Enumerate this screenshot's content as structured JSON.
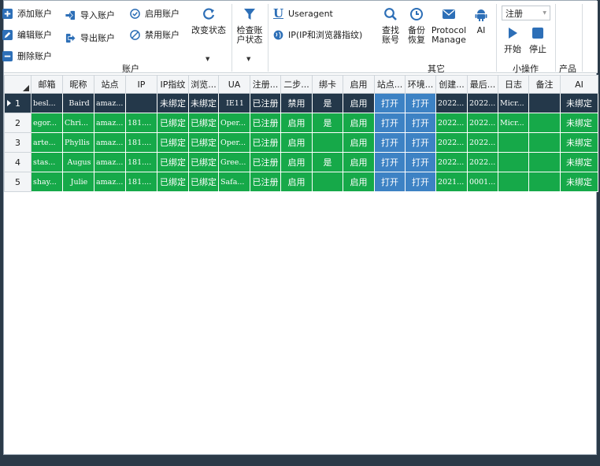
{
  "ribbon": {
    "account": {
      "add": "添加账户",
      "edit": "编辑账户",
      "delete": "删除账户",
      "import": "导入账户",
      "export": "导出账户",
      "enable": "启用账户",
      "disable": "禁用账户",
      "change_status": "改变状态",
      "check_status_l1": "检查账",
      "check_status_l2": "户状态",
      "group_label": "账户"
    },
    "other": {
      "useragent": "Useragent",
      "ip_fingerprint": "IP(IP和浏览器指纹)",
      "find_l1": "查找",
      "find_l2": "账号",
      "backup_l1": "备份",
      "backup_l2": "恢复",
      "protocol_l1": "Protocol",
      "protocol_l2": "Manage",
      "ai": "AI",
      "group_label": "其它"
    },
    "small_ops": {
      "combo_value": "注册",
      "start": "开始",
      "stop": "停止",
      "group_label": "小操作"
    },
    "product": {
      "group_label": "产品"
    }
  },
  "grid": {
    "columns": [
      "邮箱",
      "昵称",
      "站点",
      "IP",
      "IP指纹",
      "浏览...",
      "UA",
      "注册...",
      "二步...",
      "绑卡",
      "启用",
      "站点...",
      "环境...",
      "创建...",
      "最后...",
      "日志",
      "备注",
      "AI"
    ],
    "rows": [
      {
        "n": "1",
        "email": "besl...",
        "nick": "Baird",
        "site": "amaz...",
        "ip": "",
        "ipfp": "未绑定",
        "browser": "未绑定",
        "ua": "IE11",
        "reg": "已注册",
        "twostep": "禁用",
        "card": "是",
        "enabled": "启用",
        "site_open": "打开",
        "env_open": "打开",
        "created": "2022...",
        "last": "2022...",
        "log": "Micr...",
        "note": "",
        "ai": "未绑定"
      },
      {
        "n": "2",
        "email": "egor...",
        "nick": "Chri...",
        "site": "amaz...",
        "ip": "181....",
        "ipfp": "已绑定",
        "browser": "已绑定",
        "ua": "Oper...",
        "reg": "已注册",
        "twostep": "启用",
        "card": "是",
        "enabled": "启用",
        "site_open": "打开",
        "env_open": "打开",
        "created": "2022...",
        "last": "2022...",
        "log": "Micr...",
        "note": "",
        "ai": "未绑定"
      },
      {
        "n": "3",
        "email": "arte...",
        "nick": "Phyllis",
        "site": "amaz...",
        "ip": "181....",
        "ipfp": "已绑定",
        "browser": "已绑定",
        "ua": "Oper...",
        "reg": "已注册",
        "twostep": "启用",
        "card": "",
        "enabled": "启用",
        "site_open": "打开",
        "env_open": "打开",
        "created": "2022...",
        "last": "2022...",
        "log": "",
        "note": "",
        "ai": "未绑定"
      },
      {
        "n": "4",
        "email": "stas...",
        "nick": "Augus",
        "site": "amaz...",
        "ip": "181....",
        "ipfp": "已绑定",
        "browser": "已绑定",
        "ua": "Gree...",
        "reg": "已注册",
        "twostep": "启用",
        "card": "是",
        "enabled": "启用",
        "site_open": "打开",
        "env_open": "打开",
        "created": "2022...",
        "last": "2022...",
        "log": "",
        "note": "",
        "ai": "未绑定"
      },
      {
        "n": "5",
        "email": "shay...",
        "nick": "Julie",
        "site": "amaz...",
        "ip": "181....",
        "ipfp": "已绑定",
        "browser": "已绑定",
        "ua": "Safa...",
        "reg": "已注册",
        "twostep": "启用",
        "card": "",
        "enabled": "启用",
        "site_open": "打开",
        "env_open": "打开",
        "created": "2021...",
        "last": "0001...",
        "log": "",
        "note": "",
        "ai": "未绑定"
      }
    ]
  },
  "colors": {
    "row_green": "#16a949",
    "row_selected": "#24384a",
    "button_blue": "#3d82c4",
    "icon_blue": "#2d6fb7"
  }
}
